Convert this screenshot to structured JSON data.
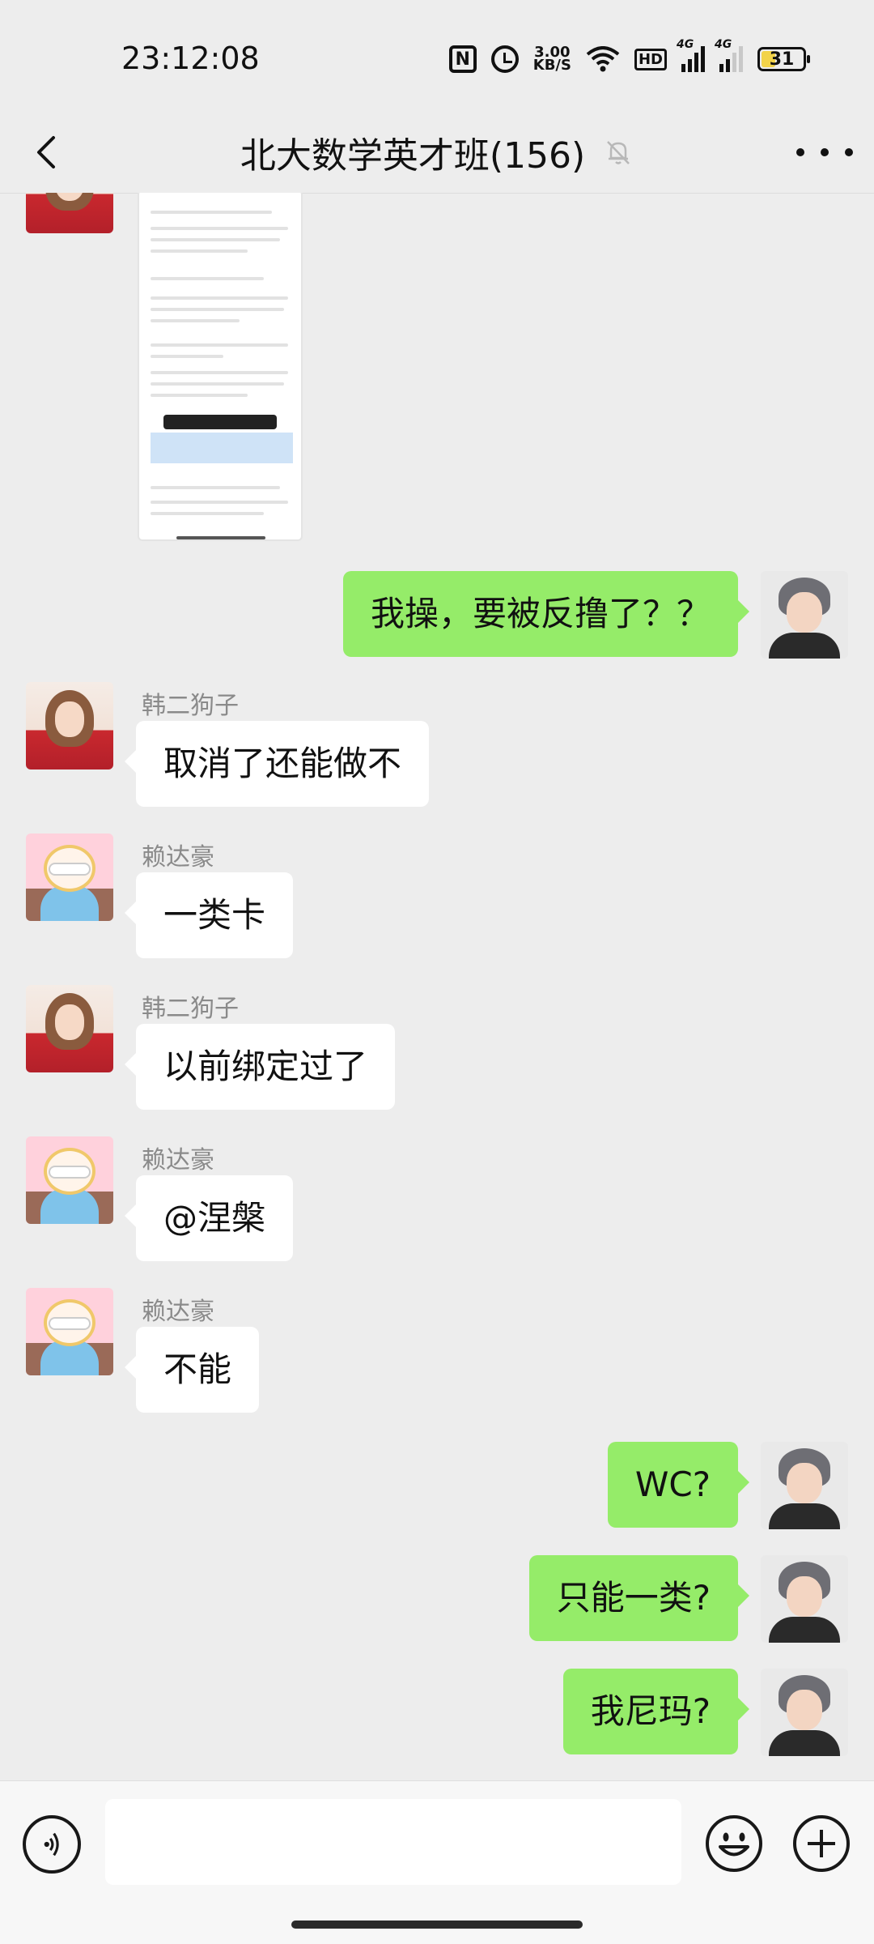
{
  "status_bar": {
    "time": "23:12:08",
    "net_speed_value": "3.00",
    "net_speed_unit": "KB/S",
    "hd_label": "HD",
    "signal_label_1": "4G",
    "signal_label_2": "4G",
    "battery": "31"
  },
  "header": {
    "title": "北大数学英才班(156)"
  },
  "messages": [
    {
      "side": "left",
      "type": "image",
      "avatar": "girl"
    },
    {
      "side": "right",
      "text": "我操，要被反撸了？？"
    },
    {
      "side": "left",
      "sender": "韩二狗子",
      "text": "取消了还能做不"
    },
    {
      "side": "left",
      "sender": "赖达豪",
      "text": "一类卡"
    },
    {
      "side": "left",
      "sender": "韩二狗子",
      "text": "以前绑定过了"
    },
    {
      "side": "left",
      "sender": "赖达豪",
      "text": "@涅槃"
    },
    {
      "side": "left",
      "sender": "赖达豪",
      "text": "不能"
    },
    {
      "side": "right",
      "text": "WC?"
    },
    {
      "side": "right",
      "text": "只能一类?"
    },
    {
      "side": "right",
      "text": "我尼玛?"
    }
  ],
  "input": {
    "value": "",
    "placeholder": ""
  },
  "colors": {
    "background": "#ededed",
    "outgoing_bubble": "#95ec69",
    "incoming_bubble": "#ffffff",
    "battery_fill": "#f2d34a"
  },
  "icons": [
    "back-icon",
    "mute-bell-icon",
    "more-icon",
    "voice-icon",
    "emoji-icon",
    "plus-icon"
  ]
}
